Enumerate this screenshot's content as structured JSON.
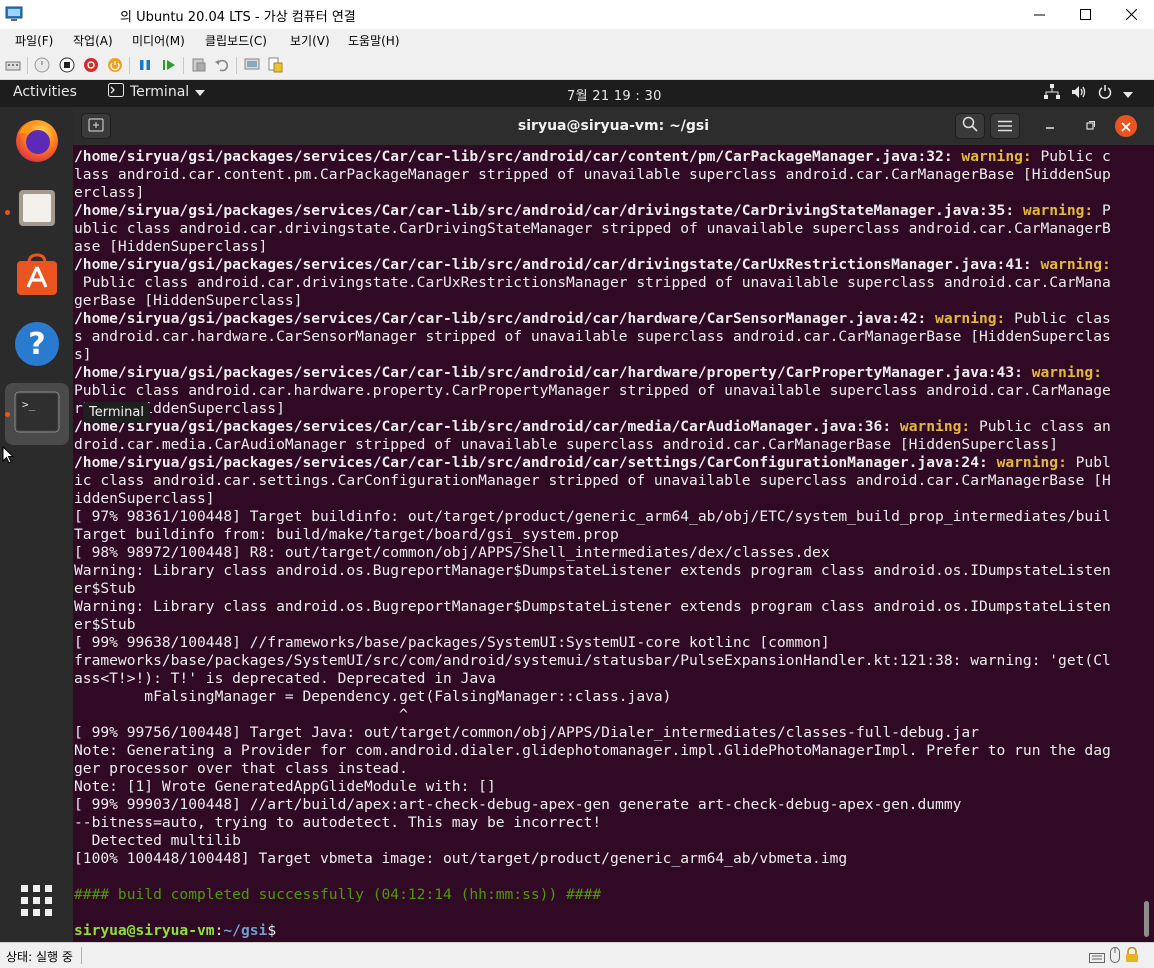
{
  "host": {
    "title": "의 Ubuntu 20.04 LTS - 가상 컴퓨터 연결",
    "menu": [
      "파일(F)",
      "작업(A)",
      "미디어(M)",
      "클립보드(C)",
      "보기(V)",
      "도움말(H)"
    ],
    "status": "상태: 실행 중"
  },
  "topbar": {
    "activities": "Activities",
    "app_name": "Terminal",
    "clock": "7월 21  19 : 30"
  },
  "dock": {
    "tooltip": "Terminal",
    "items": [
      "firefox",
      "files",
      "ubuntu-software",
      "help",
      "terminal",
      "show-applications"
    ]
  },
  "terminal": {
    "title": "siryua@siryua-vm: ~/gsi",
    "prompt_user": "siryua@siryua-vm",
    "prompt_sep": ":",
    "prompt_path": "~/gsi",
    "prompt_end": "$",
    "lines": [
      {
        "parts": [
          {
            "t": "/home/siryua/gsi/packages/services/Car/car-lib/src/android/car/content/pm/CarPackageManager.java:32: ",
            "c": "bold"
          },
          {
            "t": "warning:",
            "c": "warn"
          },
          {
            "t": " Public c",
            "c": ""
          }
        ]
      },
      {
        "parts": [
          {
            "t": "lass android.car.content.pm.CarPackageManager stripped of unavailable superclass android.car.CarManagerBase [HiddenSup",
            "c": ""
          }
        ]
      },
      {
        "parts": [
          {
            "t": "erclass]",
            "c": ""
          }
        ]
      },
      {
        "parts": [
          {
            "t": "/home/siryua/gsi/packages/services/Car/car-lib/src/android/car/drivingstate/CarDrivingStateManager.java:35: ",
            "c": "bold"
          },
          {
            "t": "warning:",
            "c": "warn"
          },
          {
            "t": " P",
            "c": ""
          }
        ]
      },
      {
        "parts": [
          {
            "t": "ublic class android.car.drivingstate.CarDrivingStateManager stripped of unavailable superclass android.car.CarManagerB",
            "c": ""
          }
        ]
      },
      {
        "parts": [
          {
            "t": "ase [HiddenSuperclass]",
            "c": ""
          }
        ]
      },
      {
        "parts": [
          {
            "t": "/home/siryua/gsi/packages/services/Car/car-lib/src/android/car/drivingstate/CarUxRestrictionsManager.java:41: ",
            "c": "bold"
          },
          {
            "t": "warning:",
            "c": "warn"
          }
        ]
      },
      {
        "parts": [
          {
            "t": " Public class android.car.drivingstate.CarUxRestrictionsManager stripped of unavailable superclass android.car.CarMana",
            "c": ""
          }
        ]
      },
      {
        "parts": [
          {
            "t": "gerBase [HiddenSuperclass]",
            "c": ""
          }
        ]
      },
      {
        "parts": [
          {
            "t": "/home/siryua/gsi/packages/services/Car/car-lib/src/android/car/hardware/CarSensorManager.java:42: ",
            "c": "bold"
          },
          {
            "t": "warning:",
            "c": "warn"
          },
          {
            "t": " Public clas",
            "c": ""
          }
        ]
      },
      {
        "parts": [
          {
            "t": "s android.car.hardware.CarSensorManager stripped of unavailable superclass android.car.CarManagerBase [HiddenSuperclas",
            "c": ""
          }
        ]
      },
      {
        "parts": [
          {
            "t": "s]",
            "c": ""
          }
        ]
      },
      {
        "parts": [
          {
            "t": "/home/siryua/gsi/packages/services/Car/car-lib/src/android/car/hardware/property/CarPropertyManager.java:43: ",
            "c": "bold"
          },
          {
            "t": "warning:",
            "c": "warn"
          }
        ]
      },
      {
        "parts": [
          {
            "t": "Public class android.car.hardware.property.CarPropertyManager stripped of unavailable superclass android.car.CarManage",
            "c": ""
          }
        ]
      },
      {
        "parts": [
          {
            "t": "rBase [HiddenSuperclass]",
            "c": ""
          }
        ]
      },
      {
        "parts": [
          {
            "t": "/home/siryua/gsi/packages/services/Car/car-lib/src/android/car/media/CarAudioManager.java:36: ",
            "c": "bold"
          },
          {
            "t": "warning:",
            "c": "warn"
          },
          {
            "t": " Public class an",
            "c": ""
          }
        ]
      },
      {
        "parts": [
          {
            "t": "droid.car.media.CarAudioManager stripped of unavailable superclass android.car.CarManagerBase [HiddenSuperclass]",
            "c": ""
          }
        ]
      },
      {
        "parts": [
          {
            "t": "/home/siryua/gsi/packages/services/Car/car-lib/src/android/car/settings/CarConfigurationManager.java:24: ",
            "c": "bold"
          },
          {
            "t": "warning:",
            "c": "warn"
          },
          {
            "t": " Publ",
            "c": ""
          }
        ]
      },
      {
        "parts": [
          {
            "t": "ic class android.car.settings.CarConfigurationManager stripped of unavailable superclass android.car.CarManagerBase [H",
            "c": ""
          }
        ]
      },
      {
        "parts": [
          {
            "t": "iddenSuperclass]",
            "c": ""
          }
        ]
      },
      {
        "parts": [
          {
            "t": "[ 97% 98361/100448] Target buildinfo: out/target/product/generic_arm64_ab/obj/ETC/system_build_prop_intermediates/buil",
            "c": ""
          }
        ]
      },
      {
        "parts": [
          {
            "t": "Target buildinfo from: build/make/target/board/gsi_system.prop",
            "c": ""
          }
        ]
      },
      {
        "parts": [
          {
            "t": "[ 98% 98972/100448] R8: out/target/common/obj/APPS/Shell_intermediates/dex/classes.dex",
            "c": ""
          }
        ]
      },
      {
        "parts": [
          {
            "t": "Warning: Library class android.os.BugreportManager$DumpstateListener extends program class android.os.IDumpstateListen",
            "c": ""
          }
        ]
      },
      {
        "parts": [
          {
            "t": "er$Stub",
            "c": ""
          }
        ]
      },
      {
        "parts": [
          {
            "t": "Warning: Library class android.os.BugreportManager$DumpstateListener extends program class android.os.IDumpstateListen",
            "c": ""
          }
        ]
      },
      {
        "parts": [
          {
            "t": "er$Stub",
            "c": ""
          }
        ]
      },
      {
        "parts": [
          {
            "t": "[ 99% 99638/100448] //frameworks/base/packages/SystemUI:SystemUI-core kotlinc [common]",
            "c": ""
          }
        ]
      },
      {
        "parts": [
          {
            "t": "frameworks/base/packages/SystemUI/src/com/android/systemui/statusbar/PulseExpansionHandler.kt:121:38: warning: 'get(Cl",
            "c": ""
          }
        ]
      },
      {
        "parts": [
          {
            "t": "ass<T!>!): T!' is deprecated. Deprecated in Java",
            "c": ""
          }
        ]
      },
      {
        "parts": [
          {
            "t": "        mFalsingManager = Dependency.get(FalsingManager::class.java)",
            "c": ""
          }
        ]
      },
      {
        "parts": [
          {
            "t": "                                     ^",
            "c": ""
          }
        ]
      },
      {
        "parts": [
          {
            "t": "[ 99% 99756/100448] Target Java: out/target/common/obj/APPS/Dialer_intermediates/classes-full-debug.jar",
            "c": ""
          }
        ]
      },
      {
        "parts": [
          {
            "t": "Note: Generating a Provider for com.android.dialer.glidephotomanager.impl.GlidePhotoManagerImpl. Prefer to run the dag",
            "c": ""
          }
        ]
      },
      {
        "parts": [
          {
            "t": "ger processor over that class instead.",
            "c": ""
          }
        ]
      },
      {
        "parts": [
          {
            "t": "Note: [1] Wrote GeneratedAppGlideModule with: []",
            "c": ""
          }
        ]
      },
      {
        "parts": [
          {
            "t": "[ 99% 99903/100448] //art/build/apex:art-check-debug-apex-gen generate art-check-debug-apex-gen.dummy",
            "c": ""
          }
        ]
      },
      {
        "parts": [
          {
            "t": "--bitness=auto, trying to autodetect. This may be incorrect!",
            "c": ""
          }
        ]
      },
      {
        "parts": [
          {
            "t": "  Detected multilib",
            "c": ""
          }
        ]
      },
      {
        "parts": [
          {
            "t": "[100% 100448/100448] Target vbmeta image: out/target/product/generic_arm64_ab/vbmeta.img",
            "c": ""
          }
        ]
      },
      {
        "parts": [
          {
            "t": "",
            "c": ""
          }
        ]
      },
      {
        "parts": [
          {
            "t": "#### build completed successfully (04:12:14 (hh:mm:ss)) ####",
            "c": "grn"
          }
        ]
      },
      {
        "parts": [
          {
            "t": "",
            "c": ""
          }
        ]
      }
    ]
  }
}
